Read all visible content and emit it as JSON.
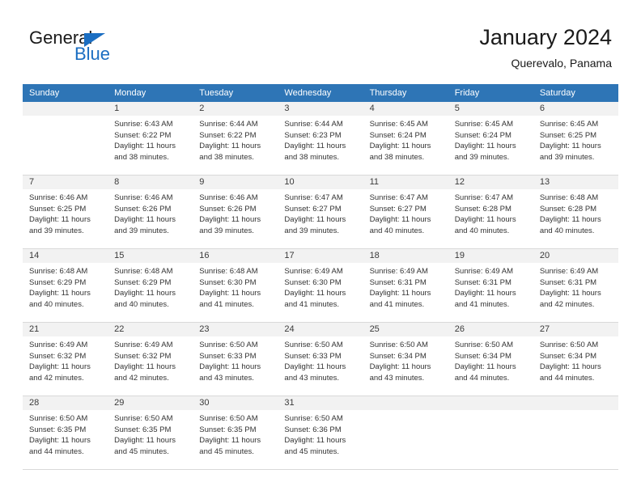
{
  "brand": {
    "word_top": "General",
    "word_bottom": "Blue",
    "triangle_icon": "brand-triangle-icon",
    "accent_color": "#1b6ec2"
  },
  "header": {
    "title": "January 2024",
    "subtitle": "Querevalo, Panama"
  },
  "calendar": {
    "header_color": "#2E75B6",
    "daynum_band_color": "#f2f2f2",
    "weekdays": [
      "Sunday",
      "Monday",
      "Tuesday",
      "Wednesday",
      "Thursday",
      "Friday",
      "Saturday"
    ],
    "weeks": [
      [
        {
          "day": "",
          "sunrise": "",
          "sunset": "",
          "daylight_1": "",
          "daylight_2": "",
          "blank": true
        },
        {
          "day": "1",
          "sunrise": "Sunrise: 6:43 AM",
          "sunset": "Sunset: 6:22 PM",
          "daylight_1": "Daylight: 11 hours",
          "daylight_2": "and 38 minutes."
        },
        {
          "day": "2",
          "sunrise": "Sunrise: 6:44 AM",
          "sunset": "Sunset: 6:22 PM",
          "daylight_1": "Daylight: 11 hours",
          "daylight_2": "and 38 minutes."
        },
        {
          "day": "3",
          "sunrise": "Sunrise: 6:44 AM",
          "sunset": "Sunset: 6:23 PM",
          "daylight_1": "Daylight: 11 hours",
          "daylight_2": "and 38 minutes."
        },
        {
          "day": "4",
          "sunrise": "Sunrise: 6:45 AM",
          "sunset": "Sunset: 6:24 PM",
          "daylight_1": "Daylight: 11 hours",
          "daylight_2": "and 38 minutes."
        },
        {
          "day": "5",
          "sunrise": "Sunrise: 6:45 AM",
          "sunset": "Sunset: 6:24 PM",
          "daylight_1": "Daylight: 11 hours",
          "daylight_2": "and 39 minutes."
        },
        {
          "day": "6",
          "sunrise": "Sunrise: 6:45 AM",
          "sunset": "Sunset: 6:25 PM",
          "daylight_1": "Daylight: 11 hours",
          "daylight_2": "and 39 minutes."
        }
      ],
      [
        {
          "day": "7",
          "sunrise": "Sunrise: 6:46 AM",
          "sunset": "Sunset: 6:25 PM",
          "daylight_1": "Daylight: 11 hours",
          "daylight_2": "and 39 minutes."
        },
        {
          "day": "8",
          "sunrise": "Sunrise: 6:46 AM",
          "sunset": "Sunset: 6:26 PM",
          "daylight_1": "Daylight: 11 hours",
          "daylight_2": "and 39 minutes."
        },
        {
          "day": "9",
          "sunrise": "Sunrise: 6:46 AM",
          "sunset": "Sunset: 6:26 PM",
          "daylight_1": "Daylight: 11 hours",
          "daylight_2": "and 39 minutes."
        },
        {
          "day": "10",
          "sunrise": "Sunrise: 6:47 AM",
          "sunset": "Sunset: 6:27 PM",
          "daylight_1": "Daylight: 11 hours",
          "daylight_2": "and 39 minutes."
        },
        {
          "day": "11",
          "sunrise": "Sunrise: 6:47 AM",
          "sunset": "Sunset: 6:27 PM",
          "daylight_1": "Daylight: 11 hours",
          "daylight_2": "and 40 minutes."
        },
        {
          "day": "12",
          "sunrise": "Sunrise: 6:47 AM",
          "sunset": "Sunset: 6:28 PM",
          "daylight_1": "Daylight: 11 hours",
          "daylight_2": "and 40 minutes."
        },
        {
          "day": "13",
          "sunrise": "Sunrise: 6:48 AM",
          "sunset": "Sunset: 6:28 PM",
          "daylight_1": "Daylight: 11 hours",
          "daylight_2": "and 40 minutes."
        }
      ],
      [
        {
          "day": "14",
          "sunrise": "Sunrise: 6:48 AM",
          "sunset": "Sunset: 6:29 PM",
          "daylight_1": "Daylight: 11 hours",
          "daylight_2": "and 40 minutes."
        },
        {
          "day": "15",
          "sunrise": "Sunrise: 6:48 AM",
          "sunset": "Sunset: 6:29 PM",
          "daylight_1": "Daylight: 11 hours",
          "daylight_2": "and 40 minutes."
        },
        {
          "day": "16",
          "sunrise": "Sunrise: 6:48 AM",
          "sunset": "Sunset: 6:30 PM",
          "daylight_1": "Daylight: 11 hours",
          "daylight_2": "and 41 minutes."
        },
        {
          "day": "17",
          "sunrise": "Sunrise: 6:49 AM",
          "sunset": "Sunset: 6:30 PM",
          "daylight_1": "Daylight: 11 hours",
          "daylight_2": "and 41 minutes."
        },
        {
          "day": "18",
          "sunrise": "Sunrise: 6:49 AM",
          "sunset": "Sunset: 6:31 PM",
          "daylight_1": "Daylight: 11 hours",
          "daylight_2": "and 41 minutes."
        },
        {
          "day": "19",
          "sunrise": "Sunrise: 6:49 AM",
          "sunset": "Sunset: 6:31 PM",
          "daylight_1": "Daylight: 11 hours",
          "daylight_2": "and 41 minutes."
        },
        {
          "day": "20",
          "sunrise": "Sunrise: 6:49 AM",
          "sunset": "Sunset: 6:31 PM",
          "daylight_1": "Daylight: 11 hours",
          "daylight_2": "and 42 minutes."
        }
      ],
      [
        {
          "day": "21",
          "sunrise": "Sunrise: 6:49 AM",
          "sunset": "Sunset: 6:32 PM",
          "daylight_1": "Daylight: 11 hours",
          "daylight_2": "and 42 minutes."
        },
        {
          "day": "22",
          "sunrise": "Sunrise: 6:49 AM",
          "sunset": "Sunset: 6:32 PM",
          "daylight_1": "Daylight: 11 hours",
          "daylight_2": "and 42 minutes."
        },
        {
          "day": "23",
          "sunrise": "Sunrise: 6:50 AM",
          "sunset": "Sunset: 6:33 PM",
          "daylight_1": "Daylight: 11 hours",
          "daylight_2": "and 43 minutes."
        },
        {
          "day": "24",
          "sunrise": "Sunrise: 6:50 AM",
          "sunset": "Sunset: 6:33 PM",
          "daylight_1": "Daylight: 11 hours",
          "daylight_2": "and 43 minutes."
        },
        {
          "day": "25",
          "sunrise": "Sunrise: 6:50 AM",
          "sunset": "Sunset: 6:34 PM",
          "daylight_1": "Daylight: 11 hours",
          "daylight_2": "and 43 minutes."
        },
        {
          "day": "26",
          "sunrise": "Sunrise: 6:50 AM",
          "sunset": "Sunset: 6:34 PM",
          "daylight_1": "Daylight: 11 hours",
          "daylight_2": "and 44 minutes."
        },
        {
          "day": "27",
          "sunrise": "Sunrise: 6:50 AM",
          "sunset": "Sunset: 6:34 PM",
          "daylight_1": "Daylight: 11 hours",
          "daylight_2": "and 44 minutes."
        }
      ],
      [
        {
          "day": "28",
          "sunrise": "Sunrise: 6:50 AM",
          "sunset": "Sunset: 6:35 PM",
          "daylight_1": "Daylight: 11 hours",
          "daylight_2": "and 44 minutes."
        },
        {
          "day": "29",
          "sunrise": "Sunrise: 6:50 AM",
          "sunset": "Sunset: 6:35 PM",
          "daylight_1": "Daylight: 11 hours",
          "daylight_2": "and 45 minutes."
        },
        {
          "day": "30",
          "sunrise": "Sunrise: 6:50 AM",
          "sunset": "Sunset: 6:35 PM",
          "daylight_1": "Daylight: 11 hours",
          "daylight_2": "and 45 minutes."
        },
        {
          "day": "31",
          "sunrise": "Sunrise: 6:50 AM",
          "sunset": "Sunset: 6:36 PM",
          "daylight_1": "Daylight: 11 hours",
          "daylight_2": "and 45 minutes."
        },
        {
          "day": "",
          "sunrise": "",
          "sunset": "",
          "daylight_1": "",
          "daylight_2": "",
          "blank": true
        },
        {
          "day": "",
          "sunrise": "",
          "sunset": "",
          "daylight_1": "",
          "daylight_2": "",
          "blank": true
        },
        {
          "day": "",
          "sunrise": "",
          "sunset": "",
          "daylight_1": "",
          "daylight_2": "",
          "blank": true
        }
      ]
    ]
  }
}
